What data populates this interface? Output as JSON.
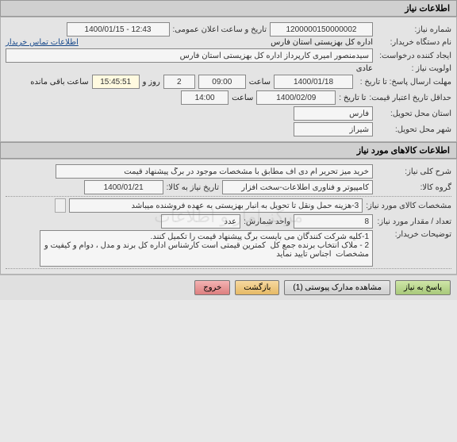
{
  "section1": {
    "title": "اطلاعات نیاز",
    "rows": {
      "need_no_label": "شماره نیاز:",
      "need_no": "1200000150000002",
      "pub_date_label": "تاریخ و ساعت اعلان عمومی:",
      "pub_date": "1400/01/15 - 12:43",
      "buyer_org_label": "نام دستگاه خریدار:",
      "buyer_org": "اداره کل بهزیستی استان فارس",
      "contact_link": "اطلاعات تماس خریدار",
      "creator_label": "ایجاد کننده درخواست:",
      "creator": "سیدمنصور امیری کارپرداز اداره کل بهزیستی استان فارس",
      "priority_label": "اولویت نیاز :",
      "priority": "عادی",
      "deadline_label": "مهلت ارسال پاسخ:  تا تاریخ :",
      "deadline_date": "1400/01/18",
      "time_label": "ساعت",
      "deadline_time": "09:00",
      "days_count": "2",
      "days_label": "روز و",
      "countdown": "15:45:51",
      "countdown_label": "ساعت باقی مانده",
      "valid_label": "حداقل تاریخ اعتبار قیمت:",
      "valid_to_label": "تا تاریخ :",
      "valid_date": "1400/02/09",
      "valid_time": "14:00",
      "delivery_prov_label": "استان محل تحویل:",
      "delivery_prov": "فارس",
      "delivery_city_label": "شهر محل تحویل:",
      "delivery_city": "شیراز"
    }
  },
  "section2": {
    "title": "اطلاعات کالاهای مورد نیاز",
    "rows": {
      "desc_label": "شرح کلی نیاز:",
      "desc": "خرید میز تحریر ام دی اف مطابق با مشخصات موجود در برگ پیشنهاد قیمت",
      "group_label": "گروه کالا:",
      "group": "کامپیوتر و فناوری اطلاعات-سخت افزار",
      "goods_date_label": "تاریخ نیاز به کالا:",
      "goods_date": "1400/01/21",
      "spec_label": "مشخصات کالای مورد نیاز:",
      "spec": "3-هزینه حمل ونقل تا تحویل به انبار بهزیستی به عهده فروشنده میباشد",
      "qty_label": "تعداد / مقدار مورد نیاز:",
      "qty": "8",
      "unit_label": "واحد شمارش:",
      "unit": "عدد",
      "buyer_desc_label": "توضیحات خریدار:",
      "buyer_desc": "1-کلیه شرکت کنندگان می بایست برگ پیشنهاد قیمت را تکمیل کنند.\n2 - ملاک انتخاب برنده جمع کل  کمترین قیمتی است کارشناس اداره کل برند و مدل ، دوام و کیفیت و مشخصات  اجناس تایید نماید"
    },
    "watermark": "مرکز آمار و اطلاعات"
  },
  "toolbar": {
    "reply": "پاسخ به نیاز",
    "attachments": "مشاهده مدارک پیوستی (1)",
    "back": "بازگشت",
    "exit": "خروج"
  }
}
